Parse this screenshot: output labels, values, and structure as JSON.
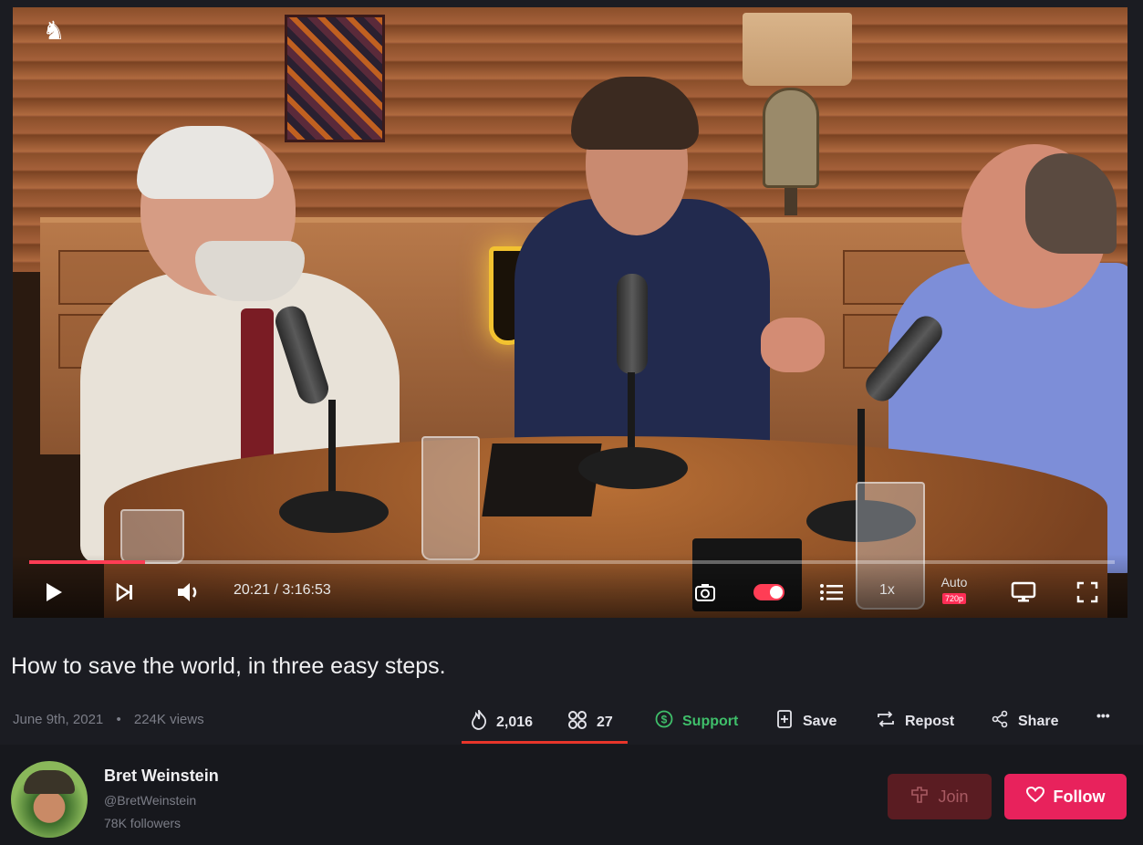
{
  "player": {
    "current_time": "20:21",
    "separator": "/",
    "duration": "3:16:53",
    "progress": 0.107,
    "speed": "1x",
    "quality_mode": "Auto",
    "quality_res": "720p",
    "icons": {
      "play": "play-icon",
      "next": "skip-next-icon",
      "volume": "volume-icon",
      "screenshot": "camera-icon",
      "autoplay": "autoplay-toggle",
      "playlist": "playlist-icon",
      "cast": "cast-icon",
      "fullscreen": "fullscreen-icon",
      "channel_logo": "horse-logo-icon"
    }
  },
  "video": {
    "title": "How to save the world, in three easy steps.",
    "date": "June 9th, 2021",
    "dot": "•",
    "views": "224K views"
  },
  "actions": {
    "rumbles": "2,016",
    "comments": "27",
    "support": "Support",
    "save": "Save",
    "repost": "Repost",
    "share": "Share",
    "more": "•••"
  },
  "channel": {
    "name": "Bret Weinstein",
    "handle": "@BretWeinstein",
    "followers": "78K followers",
    "join": "Join",
    "follow": "Follow"
  },
  "colors": {
    "accent": "#ff3d55",
    "follow_bg": "#e8225c",
    "support": "#3fbf6a",
    "background": "#1b1c22"
  }
}
